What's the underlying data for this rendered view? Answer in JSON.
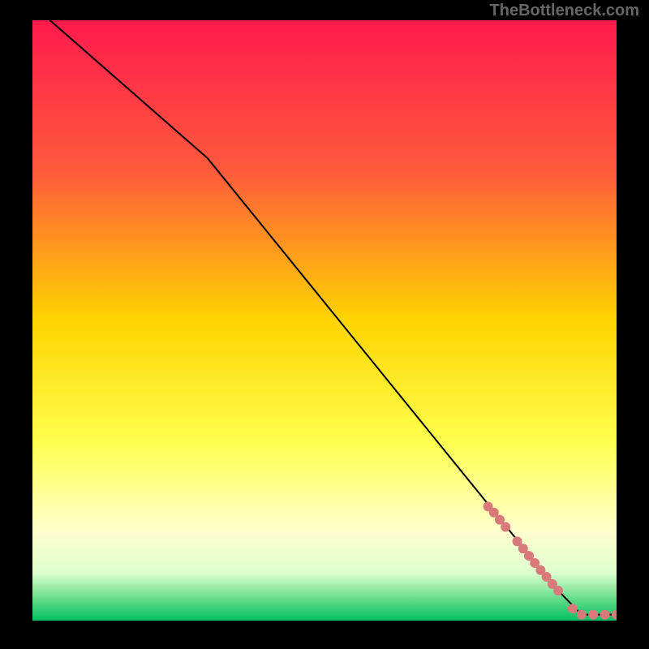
{
  "watermark": "TheBottleneck.com",
  "chart_data": {
    "type": "line",
    "title": "",
    "xlabel": "",
    "ylabel": "",
    "xlim": [
      0,
      100
    ],
    "ylim": [
      0,
      100
    ],
    "grid": false,
    "background": {
      "type": "vertical-gradient",
      "stops": [
        {
          "pos": 0.0,
          "color": "#ff1a4d"
        },
        {
          "pos": 0.25,
          "color": "#ff5a3c"
        },
        {
          "pos": 0.5,
          "color": "#ffd400"
        },
        {
          "pos": 0.7,
          "color": "#ffff4d"
        },
        {
          "pos": 0.85,
          "color": "#ffffcc"
        },
        {
          "pos": 0.92,
          "color": "#dfffd0"
        },
        {
          "pos": 0.96,
          "color": "#70e090"
        },
        {
          "pos": 1.0,
          "color": "#00c060"
        }
      ]
    },
    "line": {
      "color": "#000000",
      "width": 2,
      "points": [
        {
          "x": 3,
          "y": 100
        },
        {
          "x": 30,
          "y": 77
        },
        {
          "x": 90,
          "y": 5
        },
        {
          "x": 94,
          "y": 1
        },
        {
          "x": 100,
          "y": 1
        }
      ]
    },
    "markers": {
      "color": "#d97a7a",
      "radius": 6,
      "points": [
        {
          "x": 78,
          "y": 19.0
        },
        {
          "x": 79,
          "y": 18.0
        },
        {
          "x": 80,
          "y": 16.8
        },
        {
          "x": 81,
          "y": 15.6
        },
        {
          "x": 83,
          "y": 13.2
        },
        {
          "x": 84,
          "y": 12.0
        },
        {
          "x": 85,
          "y": 10.8
        },
        {
          "x": 86,
          "y": 9.6
        },
        {
          "x": 87,
          "y": 8.4
        },
        {
          "x": 88,
          "y": 7.3
        },
        {
          "x": 89,
          "y": 6.1
        },
        {
          "x": 90,
          "y": 5.0
        },
        {
          "x": 92.5,
          "y": 2.0
        },
        {
          "x": 94,
          "y": 1.0
        },
        {
          "x": 96,
          "y": 1.0
        },
        {
          "x": 98,
          "y": 1.0
        },
        {
          "x": 100,
          "y": 1.0
        }
      ]
    }
  }
}
